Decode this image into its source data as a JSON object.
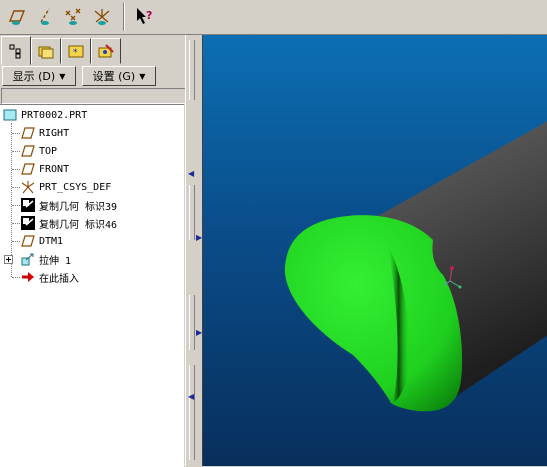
{
  "toolbar": {
    "icons": [
      "datum-plane-display-icon",
      "datum-axis-display-icon",
      "datum-point-display-icon",
      "coordinate-system-display-icon",
      "context-help-icon"
    ]
  },
  "panel": {
    "tabs": [
      "model-tree-tab",
      "folder-browser-tab",
      "favorites-tab",
      "connections-tab"
    ],
    "menus": {
      "display_label": "显示 (D)",
      "settings_label": "设置 (G)"
    }
  },
  "tree": {
    "root": "PRT0002.PRT",
    "items": [
      {
        "label": "RIGHT",
        "icon": "datum-plane-icon"
      },
      {
        "label": "TOP",
        "icon": "datum-plane-icon"
      },
      {
        "label": "FRONT",
        "icon": "datum-plane-icon"
      },
      {
        "label": "PRT_CSYS_DEF",
        "icon": "coordinate-system-icon"
      },
      {
        "label": "复制几何 标识39",
        "icon": "copy-geometry-icon"
      },
      {
        "label": "复制几何 标识46",
        "icon": "copy-geometry-icon"
      },
      {
        "label": "DTM1",
        "icon": "datum-plane-icon"
      },
      {
        "label": "拉伸 1",
        "icon": "extrude-icon"
      },
      {
        "label": "在此插入",
        "icon": "insert-here-arrow-icon"
      }
    ]
  },
  "colors": {
    "viewport_top": "#0c6fb3",
    "viewport_bottom": "#082f5c",
    "cylinder": "#4a4a4a",
    "cut_face": "#22dd22"
  }
}
